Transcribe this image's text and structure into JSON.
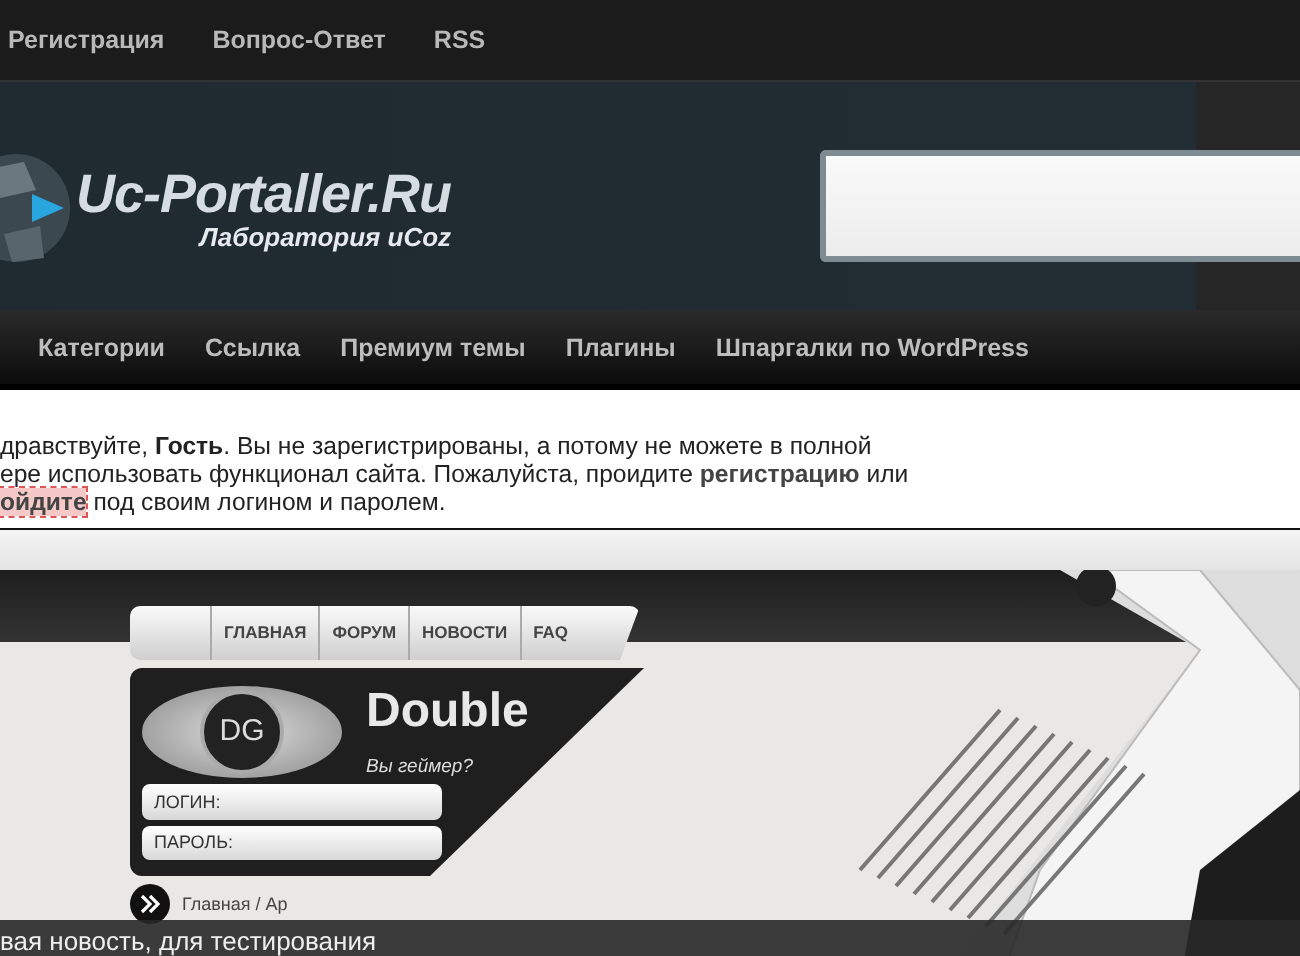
{
  "top_links": [
    "Регистрация",
    "Вопрос-Ответ",
    "RSS"
  ],
  "logo": {
    "title": "Uc-Portaller.Ru",
    "subtitle": "Лаборатория uCoz"
  },
  "nav": [
    "Категории",
    "Ссылка",
    "Премиум темы",
    "Плагины",
    "Шпаргалки по WordPress"
  ],
  "welcome": {
    "lines": [
      [
        {
          "kind": "plain",
          "text": "дравствуйте, "
        },
        {
          "kind": "bold",
          "text": "Гость"
        },
        {
          "kind": "plain",
          "text": ". Вы не зарегистрированы, а потому не можете в полной"
        }
      ],
      [
        {
          "kind": "plain",
          "text": "ере использовать функционал сайта. Пожалуйста, проидите "
        },
        {
          "kind": "link",
          "text": "регистрацию"
        },
        {
          "kind": "plain",
          "text": " или"
        }
      ],
      [
        {
          "kind": "focused-link",
          "text": "ойдите"
        },
        {
          "kind": "plain",
          "text": " под своим логином и паролем."
        }
      ]
    ]
  },
  "preview": {
    "nav": [
      "ГЛАВНАЯ",
      "ФОРУМ",
      "НОВОСТИ",
      "FAQ"
    ],
    "logo_mark": "DG",
    "title": "Double",
    "tagline": "Вы геймер?",
    "login_label": "ЛОГИН:",
    "password_label": "ПАРОЛЬ:",
    "breadcrumb": "Главная / Ар"
  },
  "caption": "вая новость, для тестирования"
}
